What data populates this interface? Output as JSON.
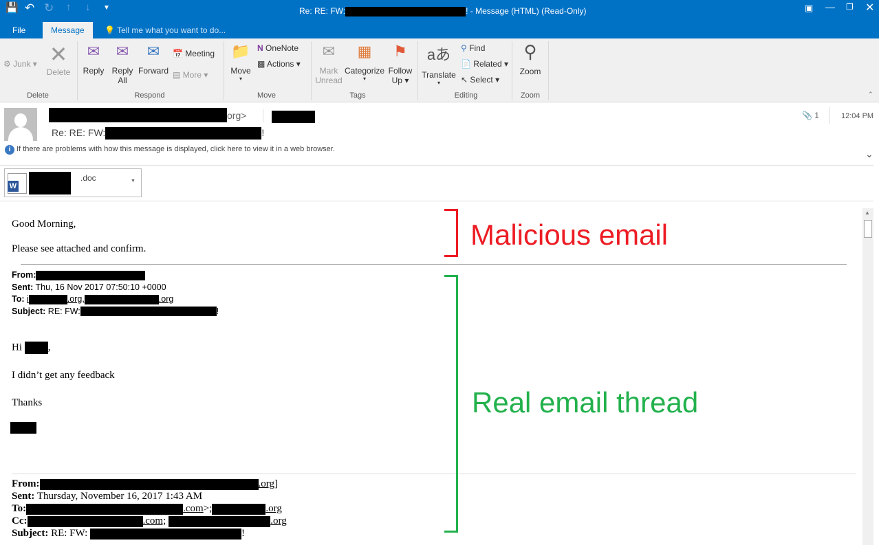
{
  "window": {
    "title_prefix": "Re: RE: FW:",
    "title_suffix": "! - Message (HTML) (Read-Only)"
  },
  "tabs": [
    {
      "label": "File"
    },
    {
      "label": "Message"
    }
  ],
  "tell_me": "Tell me what you want to do...",
  "ribbon": {
    "delete_group": {
      "label": "Delete",
      "junk": "Junk",
      "delete": "Delete"
    },
    "respond_group": {
      "label": "Respond",
      "reply": "Reply",
      "reply_all_1": "Reply",
      "reply_all_2": "All",
      "forward": "Forward",
      "meeting": "Meeting",
      "more": "More"
    },
    "move_group": {
      "label": "Move",
      "move": "Move",
      "onenote": "OneNote",
      "actions": "Actions"
    },
    "tags_group": {
      "label": "Tags",
      "mark_1": "Mark",
      "mark_2": "Unread",
      "categorize": "Categorize",
      "follow_1": "Follow",
      "follow_2": "Up"
    },
    "editing_group": {
      "label": "Editing",
      "translate": "Translate",
      "find": "Find",
      "related": "Related",
      "select": "Select"
    },
    "zoom_group": {
      "label": "Zoom",
      "zoom": "Zoom"
    }
  },
  "header": {
    "from_suffix": "org>",
    "subject_prefix": "Re: RE: FW:",
    "subject_suffix": "!",
    "attachment_count": "1",
    "time": "12:04 PM",
    "info": "If there are problems with how this message is displayed, click here to view it in a web browser."
  },
  "attachment": {
    "name_suffix": ".doc"
  },
  "body": {
    "greeting": "Good Morning,",
    "line1": "Please see attached and confirm.",
    "q1": {
      "from": "From:",
      "sent_label": "Sent:",
      "sent": " Thu, 16 Nov 2017 07:50:10 +0000",
      "to_label": "To:",
      "to_a": "i",
      "to_b": ".org,",
      "to_c": ".org",
      "subject_label": "Subject:",
      "subject": " RE: FW:",
      "subject_end": "!"
    },
    "hi": "Hi",
    "comma": ",",
    "feedback": "I didn’t get any feedback",
    "thanks": "Thanks",
    "q2": {
      "from": "From:",
      "from_end": ".org]",
      "sent_label": "Sent:",
      "sent": " Thursday, November 16, 2017 1:43 AM",
      "to_label": "To:",
      "to_a": ".com",
      "to_b": ">;",
      "to_c": ".org",
      "cc_label": "Cc:",
      "cc_a": ".com;",
      "cc_b": ".org",
      "subject_label": "Subject:",
      "subject": " RE: FW:",
      "subject_end": "!"
    }
  },
  "annotations": {
    "malicious": "Malicious email",
    "real": "Real email thread",
    "malicious_color": "#ED1C24",
    "real_color": "#22B14C"
  }
}
